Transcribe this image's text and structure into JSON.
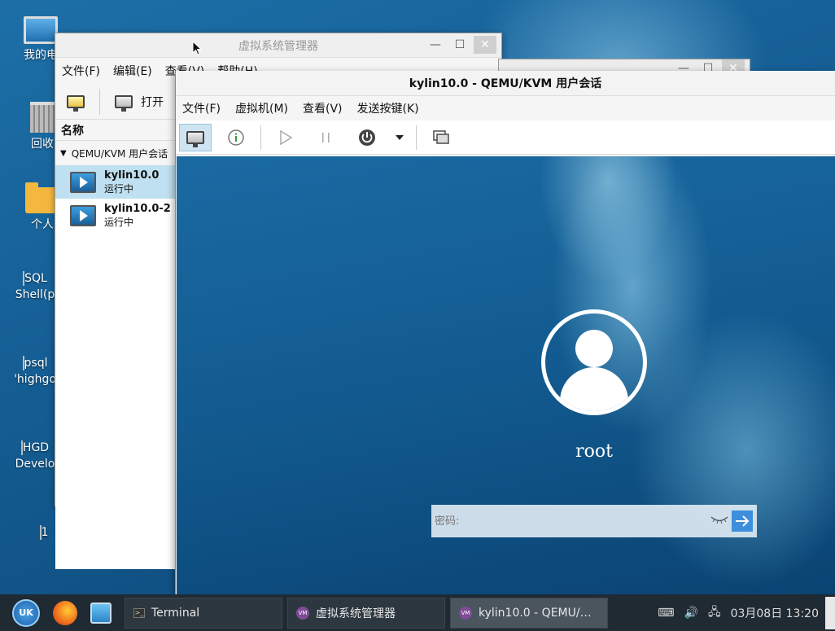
{
  "desktop": {
    "icons": [
      {
        "label": "我的电"
      },
      {
        "label": "回收"
      },
      {
        "label": "个人"
      },
      {
        "label": "SQL Shell(p"
      },
      {
        "label": "psql 'highgo"
      },
      {
        "label": "HGD Develo"
      },
      {
        "label": "1"
      }
    ]
  },
  "manager": {
    "title": "虚拟系统管理器",
    "menu": [
      "文件(F)",
      "编辑(E)",
      "查看(V)",
      "帮助(H)"
    ],
    "toolbar": {
      "open_label": "打开"
    },
    "column_header": "名称",
    "group_label": "QEMU/KVM 用户会话",
    "vms": [
      {
        "name": "kylin10.0",
        "state": "运行中"
      },
      {
        "name": "kylin10.0-2",
        "state": "运行中"
      }
    ]
  },
  "console": {
    "title": "kylin10.0 - QEMU/KVM 用户会话",
    "menu": [
      "文件(F)",
      "虚拟机(M)",
      "查看(V)",
      "发送按键(K)"
    ],
    "login": {
      "username": "root",
      "password_placeholder": "密码:"
    }
  },
  "window_buttons": {
    "minimize": "—",
    "maximize": "☐",
    "close": "✕"
  },
  "taskbar": {
    "start_label": "UK",
    "tasks": [
      {
        "label": "Terminal"
      },
      {
        "label": "虚拟系统管理器"
      },
      {
        "label": "kylin10.0 - QEMU/…"
      }
    ],
    "clock": "03月08日 13:20"
  },
  "colors": {
    "accent": "#3e8ede",
    "selection": "#bfe0f0",
    "taskbar": "#1f2a33"
  }
}
